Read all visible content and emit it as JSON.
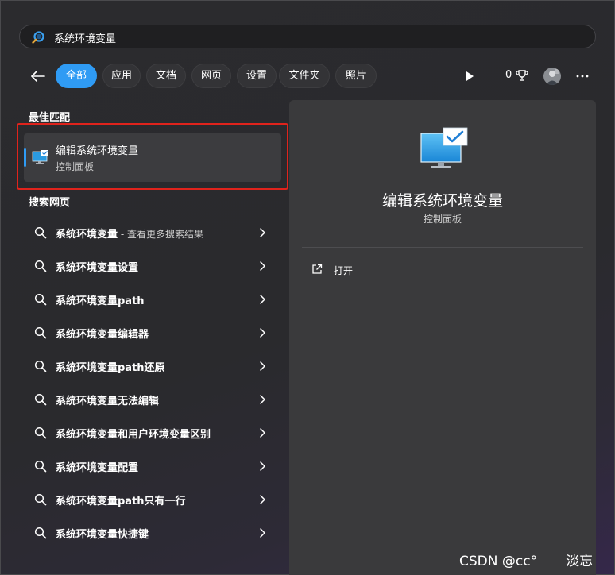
{
  "search": {
    "query": "系统环境变量"
  },
  "tabs": [
    "全部",
    "应用",
    "文档",
    "网页",
    "设置",
    "文件夹",
    "照片"
  ],
  "header": {
    "reward_points": "0"
  },
  "best_match": {
    "section_title": "最佳匹配",
    "title": "编辑系统环境变量",
    "subtitle": "控制面板"
  },
  "web": {
    "section_title": "搜索网页",
    "items": [
      {
        "label": "系统环境变量",
        "suffix": " - 查看更多搜索结果"
      },
      {
        "label": "系统环境变量设置",
        "suffix": ""
      },
      {
        "label": "系统环境变量path",
        "suffix": ""
      },
      {
        "label": "系统环境变量编辑器",
        "suffix": ""
      },
      {
        "label": "系统环境变量path还原",
        "suffix": ""
      },
      {
        "label": "系统环境变量无法编辑",
        "suffix": ""
      },
      {
        "label": "系统环境变量和用户环境变量区别",
        "suffix": ""
      },
      {
        "label": "系统环境变量配置",
        "suffix": ""
      },
      {
        "label": "系统环境变量path只有一行",
        "suffix": ""
      },
      {
        "label": "系统环境变量快捷键",
        "suffix": ""
      }
    ]
  },
  "preview": {
    "title": "编辑系统环境变量",
    "subtitle": "控制面板",
    "actions": {
      "open": "打开"
    }
  },
  "watermark": {
    "text": "CSDN @cc°",
    "name": "淡忘"
  },
  "colors": {
    "accent": "#2f9bf4",
    "highlight_frame": "#e0231c"
  }
}
